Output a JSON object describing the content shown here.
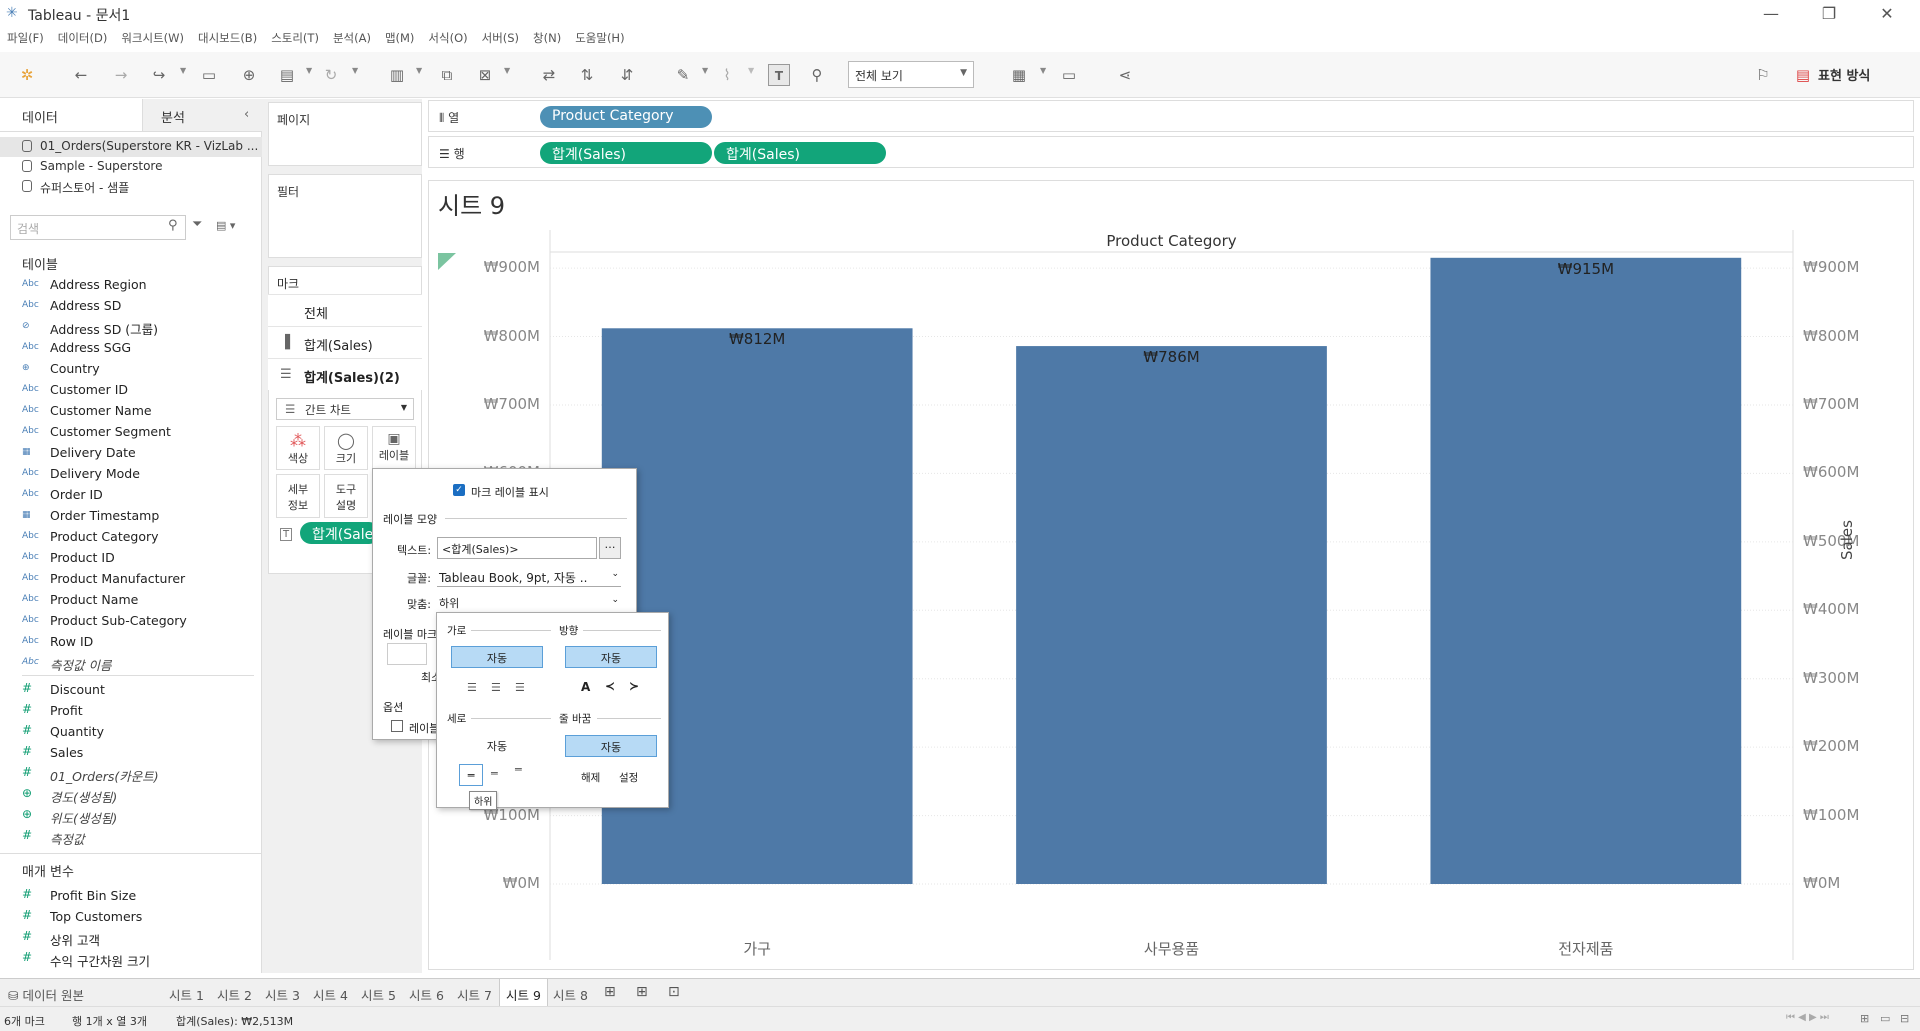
{
  "window": {
    "title": "Tableau - 문서1"
  },
  "menu": [
    "파일(F)",
    "데이터(D)",
    "워크시트(W)",
    "대시보드(B)",
    "스토리(T)",
    "분석(A)",
    "맵(M)",
    "서식(O)",
    "서버(S)",
    "창(N)",
    "도움말(H)"
  ],
  "toolbar": {
    "view_select": "전체 보기",
    "show_me": "표현 방식"
  },
  "left_panel": {
    "tab_data": "데이터",
    "tab_analysis": "분석",
    "datasources": [
      "01_Orders(Superstore KR - VizLab ...",
      "Sample - Superstore",
      "슈퍼스토어 - 샘플"
    ],
    "search_placeholder": "검색",
    "tables_header": "테이블",
    "dimensions": [
      {
        "type": "Abc",
        "name": "Address Region"
      },
      {
        "type": "Abc",
        "name": "Address SD"
      },
      {
        "type": "⊘",
        "name": "Address SD (그룹)"
      },
      {
        "type": "Abc",
        "name": "Address SGG"
      },
      {
        "type": "⊕",
        "name": "Country"
      },
      {
        "type": "Abc",
        "name": "Customer ID"
      },
      {
        "type": "Abc",
        "name": "Customer Name"
      },
      {
        "type": "Abc",
        "name": "Customer Segment"
      },
      {
        "type": "▦",
        "name": "Delivery Date"
      },
      {
        "type": "Abc",
        "name": "Delivery Mode"
      },
      {
        "type": "Abc",
        "name": "Order ID"
      },
      {
        "type": "▦",
        "name": "Order Timestamp"
      },
      {
        "type": "Abc",
        "name": "Product Category"
      },
      {
        "type": "Abc",
        "name": "Product ID"
      },
      {
        "type": "Abc",
        "name": "Product Manufacturer"
      },
      {
        "type": "Abc",
        "name": "Product Name"
      },
      {
        "type": "Abc",
        "name": "Product Sub-Category"
      },
      {
        "type": "Abc",
        "name": "Row ID"
      },
      {
        "type": "Abc",
        "name": "측정값 이름",
        "italic": true
      }
    ],
    "measures": [
      {
        "type": "#",
        "name": "Discount"
      },
      {
        "type": "#",
        "name": "Profit"
      },
      {
        "type": "#",
        "name": "Quantity"
      },
      {
        "type": "#",
        "name": "Sales"
      },
      {
        "type": "#",
        "name": "01_Orders(카운트)",
        "italic": true
      },
      {
        "type": "⊕",
        "name": "경도(생성됨)",
        "italic": true
      },
      {
        "type": "⊕",
        "name": "위도(생성됨)",
        "italic": true
      },
      {
        "type": "#",
        "name": "측정값",
        "italic": true
      }
    ],
    "params_header": "매개 변수",
    "parameters": [
      {
        "type": "#",
        "name": "Profit Bin Size"
      },
      {
        "type": "#",
        "name": "Top Customers"
      },
      {
        "type": "#",
        "name": "상위 고객"
      },
      {
        "type": "#",
        "name": "수익 구간차원 크기"
      }
    ]
  },
  "cards": {
    "pages": "페이지",
    "filters": "필터",
    "marks": "마크",
    "marks_all": "전체",
    "marks_sales": "합계(Sales)",
    "marks_sales2": "합계(Sales)(2)",
    "mark_type": "간트 차트",
    "btn_color": "색상",
    "btn_size": "크기",
    "btn_label": "레이블",
    "btn_detail": "세부\n정보",
    "btn_tooltip": "도구\n설명",
    "label_pill": "합계(Sales)"
  },
  "shelves": {
    "columns_label": "열",
    "rows_label": "행",
    "columns_pills": [
      "Product Category"
    ],
    "rows_pills": [
      "합계(Sales)",
      "합계(Sales)"
    ]
  },
  "sheet": {
    "title": "시트 9"
  },
  "chart_data": {
    "type": "bar",
    "title": "Product Category",
    "categories": [
      "가구",
      "사무용품",
      "전자제품"
    ],
    "values": [
      812,
      786,
      915
    ],
    "value_labels": [
      "₩812M",
      "₩786M",
      "₩915M"
    ],
    "ylabel": "Sales",
    "ylim": [
      0,
      960
    ],
    "yticks": [
      "₩0M",
      "₩100M",
      "₩200M",
      "₩300M",
      "₩400M",
      "₩500M",
      "₩600M",
      "₩700M",
      "₩800M",
      "₩900M"
    ],
    "bar_color": "#4e79a7"
  },
  "label_dialog": {
    "show_labels": "마크 레이블 표시",
    "appearance": "레이블 모양",
    "text_label": "텍스트:",
    "text_value": "<합계(Sales)>",
    "font_label": "글꼴:",
    "font_value": "Tableau Book, 9pt, 자동 ..",
    "align_label": "맞춤:",
    "align_value": "하위",
    "marks_label": "레이블 마크",
    "min_label": "최소",
    "options": "옵션",
    "overlap_label": "레이블"
  },
  "align_popup": {
    "horizontal": "가로",
    "direction": "방향",
    "auto1": "자동",
    "auto2": "자동",
    "vertical": "세로",
    "wrap": "줄 바꿈",
    "auto3": "자동",
    "auto4": "자동",
    "release": "해제",
    "set": "설정",
    "tooltip": "하위"
  },
  "sheet_tabs": [
    "시트 1",
    "시트 2",
    "시트 3",
    "시트 4",
    "시트 5",
    "시트 6",
    "시트 7",
    "시트 9",
    "시트 8"
  ],
  "data_source_tab": "데이터 원본",
  "status": {
    "marks": "6개 마크",
    "rows_cols": "행 1개 x 열 3개",
    "sum": "합계(Sales): ₩2,513M"
  }
}
